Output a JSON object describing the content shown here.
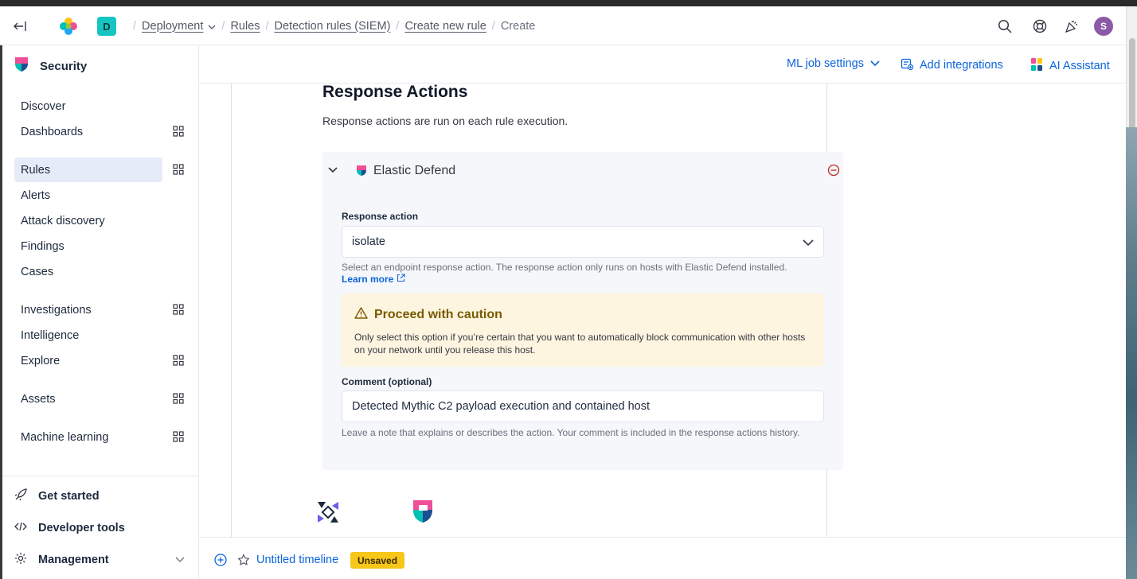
{
  "header": {
    "space_letter": "D",
    "breadcrumbs": [
      "Deployment",
      "Rules",
      "Detection rules (SIEM)",
      "Create new rule",
      "Create"
    ],
    "avatar_letter": "S"
  },
  "sidebar": {
    "title": "Security",
    "items": [
      {
        "label": "Discover"
      },
      {
        "label": "Dashboards"
      },
      {
        "label": "Rules"
      },
      {
        "label": "Alerts"
      },
      {
        "label": "Attack discovery"
      },
      {
        "label": "Findings"
      },
      {
        "label": "Cases"
      },
      {
        "label": "Investigations"
      },
      {
        "label": "Intelligence"
      },
      {
        "label": "Explore"
      },
      {
        "label": "Assets"
      },
      {
        "label": "Machine learning"
      }
    ],
    "bottom": [
      {
        "label": "Get started"
      },
      {
        "label": "Developer tools"
      },
      {
        "label": "Management"
      }
    ]
  },
  "subheader": {
    "ml_settings": "ML job settings",
    "add_integrations": "Add integrations",
    "ai_assistant": "AI Assistant"
  },
  "response_actions": {
    "title": "Response Actions",
    "description": "Response actions are run on each rule execution.",
    "action": {
      "name": "Elastic Defend",
      "response_action_label": "Response action",
      "response_action_value": "isolate",
      "response_help": "Select an endpoint response action. The response action only runs on hosts with Elastic Defend installed.",
      "learn_more": "Learn more",
      "callout_title": "Proceed with caution",
      "callout_body": "Only select this option if you’re certain that you want to automatically block communication with other hosts on your network until you release this host.",
      "comment_label": "Comment (optional)",
      "comment_value": "Detected Mythic C2 payload execution and contained host",
      "comment_help": "Leave a note that explains or describes the action. Your comment is included in the response actions history."
    }
  },
  "timeline": {
    "title": "Untitled timeline",
    "badge": "Unsaved"
  },
  "colors": {
    "link": "#0b64dd",
    "active_nav": "#e5ecf7",
    "warning_bg": "#fdf5e0",
    "warning_text": "#7a5a00",
    "unsaved_badge": "#f6c619",
    "space_badge": "#16c5c0",
    "avatar": "#8a5aa7",
    "remove_icon": "#bd271e"
  }
}
